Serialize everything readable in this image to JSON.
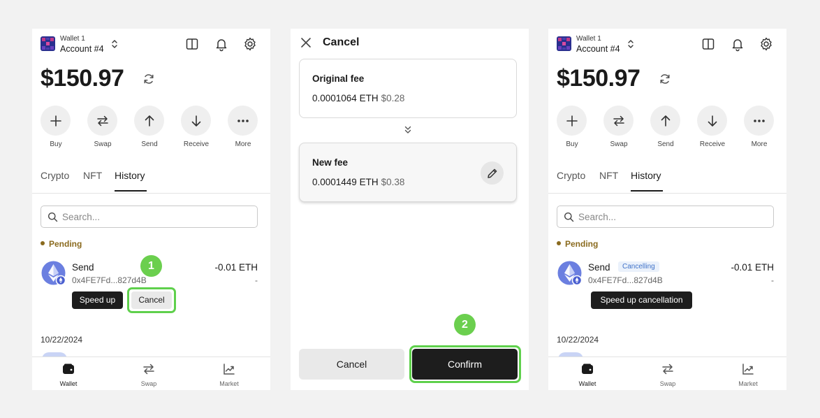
{
  "wallet": {
    "wallet_name": "Wallet 1",
    "account_name": "Account #4",
    "balance": "$150.97"
  },
  "actions": [
    {
      "label": "Buy",
      "icon": "plus-icon"
    },
    {
      "label": "Swap",
      "icon": "swap-icon"
    },
    {
      "label": "Send",
      "icon": "arrow-up-icon"
    },
    {
      "label": "Receive",
      "icon": "arrow-down-icon"
    },
    {
      "label": "More",
      "icon": "more-icon"
    }
  ],
  "tabs": [
    "Crypto",
    "NFT",
    "History"
  ],
  "active_tab": "History",
  "search": {
    "placeholder": "Search..."
  },
  "pending_label": "Pending",
  "transaction": {
    "title": "Send",
    "address": "0x4FE7Fd...827d4B",
    "amount": "-0.01 ETH",
    "sub_amount": "-"
  },
  "panel1": {
    "speed_up_label": "Speed up",
    "cancel_label": "Cancel",
    "step": "1"
  },
  "panel3": {
    "status_badge": "Cancelling",
    "speed_up_cancellation_label": "Speed up cancellation"
  },
  "date_header": "10/22/2024",
  "bottom_nav": [
    {
      "label": "Wallet",
      "icon": "wallet-icon"
    },
    {
      "label": "Swap",
      "icon": "swap-icon"
    },
    {
      "label": "Market",
      "icon": "chart-icon"
    }
  ],
  "cancel_screen": {
    "title": "Cancel",
    "original_fee": {
      "label": "Original fee",
      "eth": "0.0001064 ETH",
      "usd": "$0.28"
    },
    "new_fee": {
      "label": "New fee",
      "eth": "0.0001449 ETH",
      "usd": "$0.38"
    },
    "cancel_button": "Cancel",
    "confirm_button": "Confirm",
    "step": "2"
  },
  "colors": {
    "highlight": "#5fd04c",
    "step_badge": "#6bcf4e",
    "pending": "#8a6a1e",
    "cancelling_badge_text": "#4173c9",
    "dark_button": "#1d1d1d"
  }
}
